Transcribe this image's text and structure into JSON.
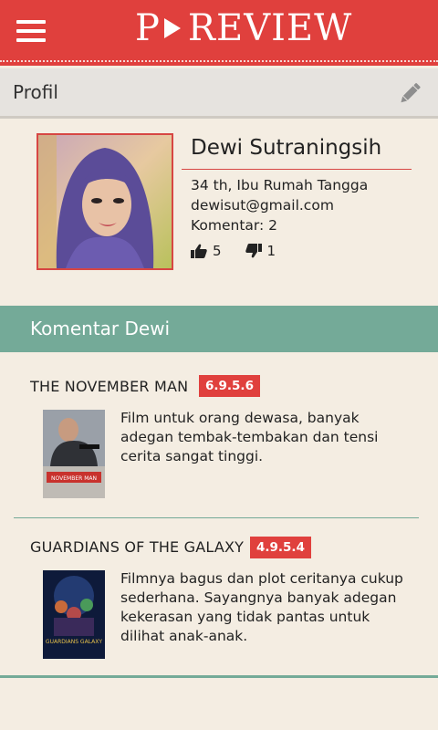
{
  "app": {
    "logo_left": "P",
    "logo_right": "REVIEW"
  },
  "header": {
    "title": "Profil"
  },
  "profile": {
    "name": "Dewi Sutraningsih",
    "details": "34 th, Ibu Rumah Tangga",
    "email": "dewisut@gmail.com",
    "comments_count": "Komentar: 2",
    "likes": "5",
    "dislikes": "1"
  },
  "section": {
    "title": "Komentar Dewi"
  },
  "comments": [
    {
      "movie": "THE NOVEMBER MAN",
      "rating": "6.9.5.6",
      "text": "Film untuk orang dewasa, banyak adegan tembak-tembakan dan tensi cerita sangat tinggi.",
      "poster_title": "NOVEMBER MAN"
    },
    {
      "movie": "GUARDIANS OF THE GALAXY",
      "rating": "4.9.5.4",
      "text": "Filmnya bagus dan plot ceritanya cukup sederhana. Sayangnya banyak adegan kekerasan yang tidak pantas untuk dilihat anak-anak.",
      "poster_title": "GUARDIANS GALAXY"
    }
  ],
  "colors": {
    "brand_red": "#e0403d",
    "section_green": "#74aa98",
    "background": "#f4ede2"
  }
}
